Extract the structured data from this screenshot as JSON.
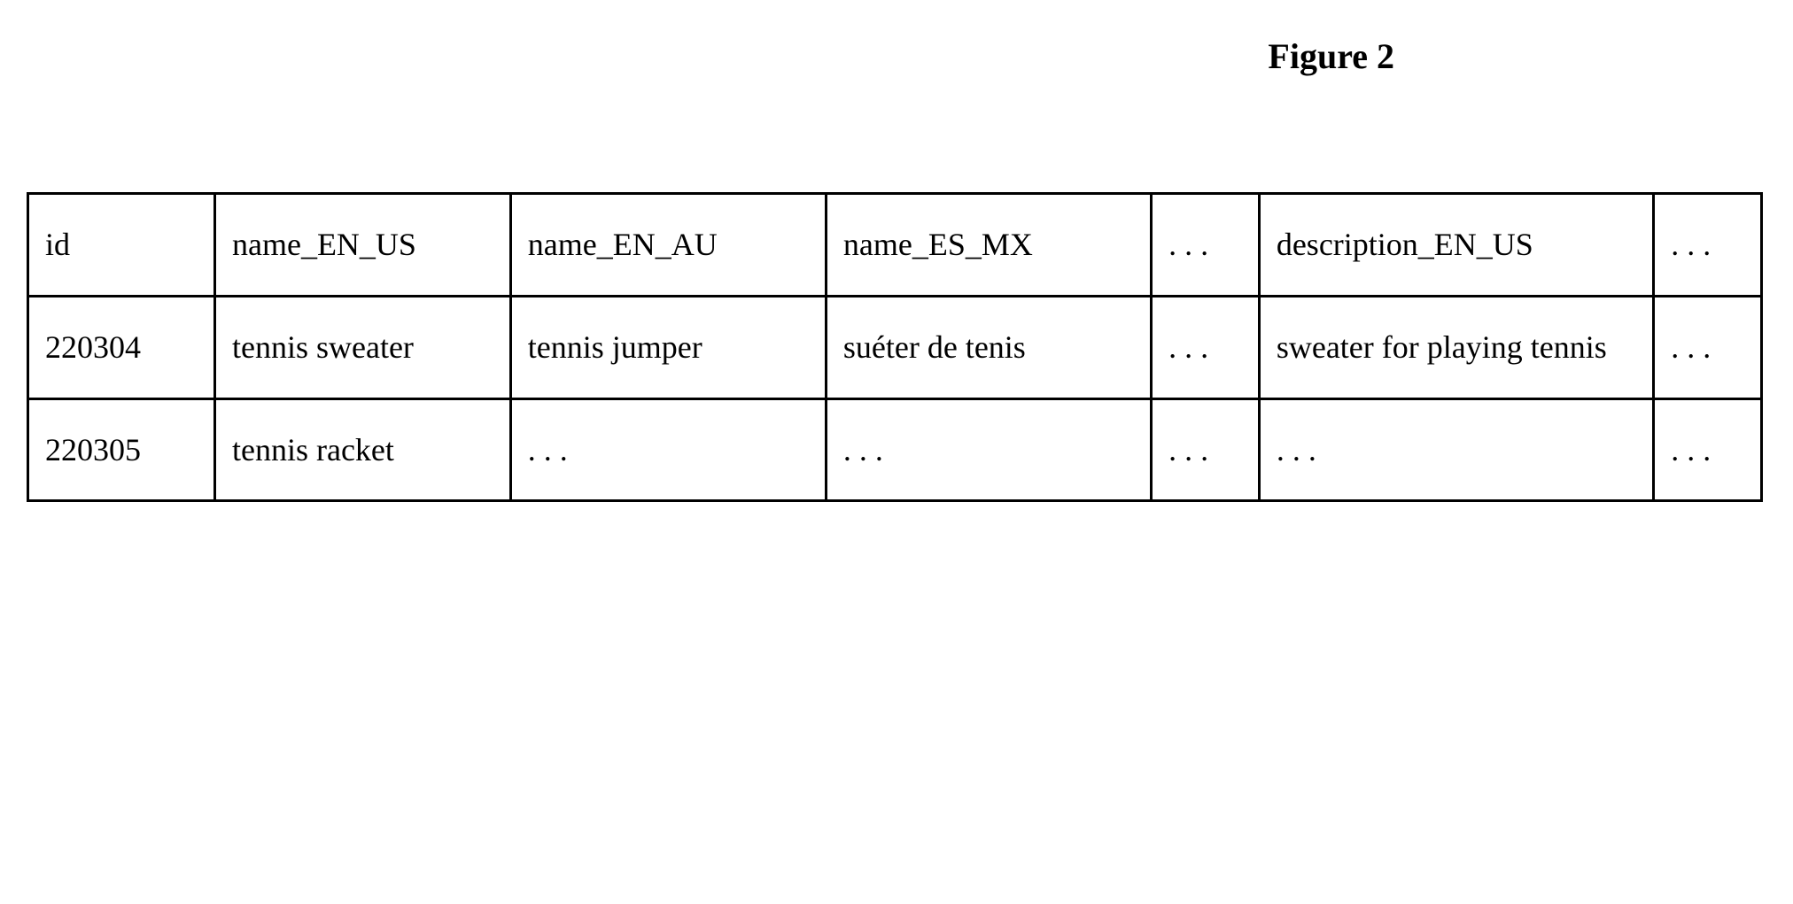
{
  "figure_title": "Figure 2",
  "table": {
    "headers": [
      "id",
      "name_EN_US",
      "name_EN_AU",
      "name_ES_MX",
      ". . .",
      "description_EN_US",
      ". . ."
    ],
    "rows": [
      [
        "220304",
        "tennis sweater",
        "tennis jumper",
        "suéter de tenis",
        ". . .",
        "sweater for playing tennis",
        ". . ."
      ],
      [
        "220305",
        "tennis racket",
        ". . .",
        ". . .",
        ". . .",
        ". . .",
        ". . ."
      ]
    ]
  }
}
